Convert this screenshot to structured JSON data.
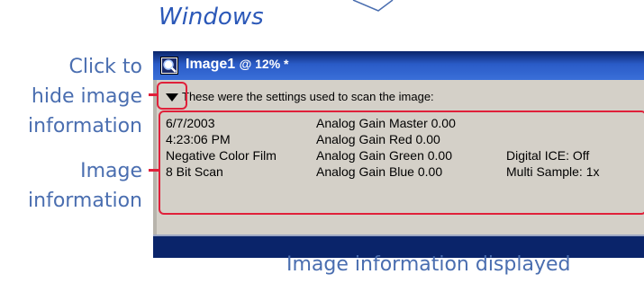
{
  "heading": "Windows",
  "callouts": {
    "hide_label_lines": [
      "Click to",
      "hide image",
      "information"
    ],
    "info_label_lines": [
      "Image",
      "information"
    ]
  },
  "window": {
    "title": "Image1",
    "zoom": "@ 12% *",
    "toggle_text": "These were the settings used to scan the image:",
    "info_columns": [
      [
        "6/7/2003",
        "4:23:06 PM",
        "Negative Color Film",
        "8 Bit Scan"
      ],
      [
        "Analog Gain Master 0.00",
        "Analog Gain Red 0.00",
        "Analog Gain Green 0.00",
        "Analog Gain Blue 0.00"
      ],
      [
        "",
        "",
        "Digital ICE: Off",
        "Multi Sample: 1x"
      ]
    ]
  },
  "caption": "Image information displayed",
  "colors": {
    "label_blue": "#4a6eb0",
    "heading_blue": "#2b58b8",
    "highlight_red": "#e0203a",
    "titlebar_dark": "#0a246a",
    "window_gray": "#d4d0c8"
  }
}
